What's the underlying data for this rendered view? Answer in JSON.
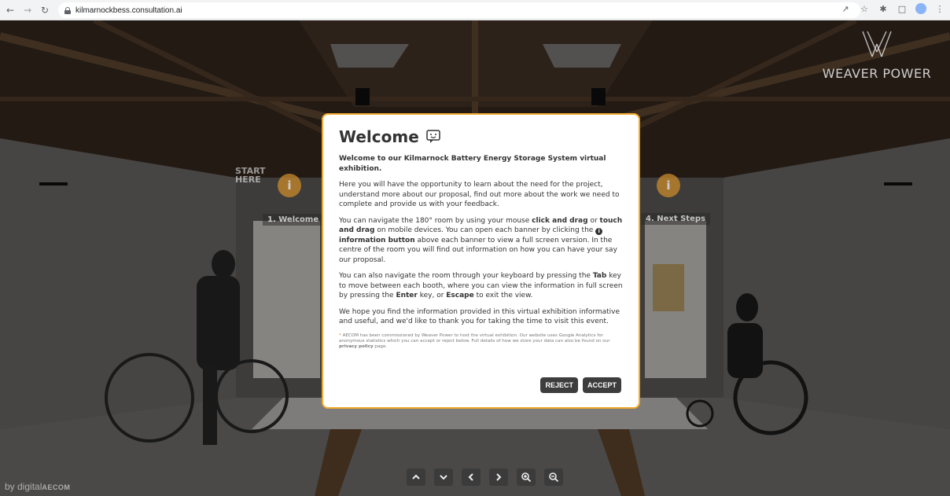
{
  "browser": {
    "url": "kilmarnockbess.consultation.ai"
  },
  "scene": {
    "start_here": "START\nHERE",
    "booth_left": "1. Welcome",
    "booth_right": "4. Next Steps",
    "info_glyph": "i"
  },
  "brand": {
    "name": "WEAVER POWER"
  },
  "footer": {
    "by_text": "by digital",
    "company": "AECOM"
  },
  "modal": {
    "title": "Welcome",
    "intro": "Welcome to our Kilmarnock Battery Energy Storage System virtual exhibition.",
    "para1": "Here you will have the opportunity to learn about the need for the project, understand more about our proposal, find out more about the work we need to complete and provide us with your feedback.",
    "para2": {
      "t1": "You can navigate the 180° room by using your mouse ",
      "b1": "click and drag",
      "t2": " or ",
      "b2": "touch and drag",
      "t3": " on mobile devices. You can open each banner by clicking the ",
      "b3": "information button",
      "t4": " above each banner to view a full screen version. In the centre of the room you will find out information on how you can have your say our proposal."
    },
    "para3": {
      "t1": "You can also navigate the room through your keyboard by pressing the ",
      "b1": "Tab",
      "t2": " key to move between each booth, where you can view the information in full screen by pressing the ",
      "b2": "Enter",
      "t3": " key, or ",
      "b3": "Escape",
      "t4": " to exit the view."
    },
    "para4": "We hope you find the information provided in this virtual exhibition informative and useful, and we'd like to thank you for taking the time to visit this event.",
    "fineprint": {
      "asterisk": "*",
      "t1": " AECOM has been commissioned by Weaver Power to host the virtual exhibition. Our website uses Google Analytics for anonymous statistics which you can accept or reject below. Full details of how we store your data can also be found on our ",
      "link": "privacy policy",
      "t2": " page."
    },
    "reject_label": "REJECT",
    "accept_label": "ACCEPT"
  },
  "controls": [
    "up",
    "down",
    "left",
    "right",
    "zoom-in",
    "zoom-out"
  ],
  "colors": {
    "modal_border": "#f0a92b",
    "button_bg": "#3d3d3d"
  }
}
